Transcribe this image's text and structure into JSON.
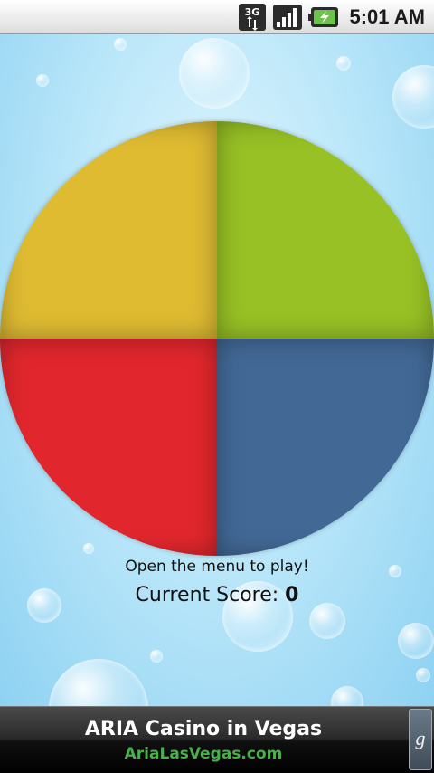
{
  "status_bar": {
    "network_label": "3G",
    "network_icon": "3g-data-icon",
    "signal_icon": "signal-strength-icon",
    "battery_icon": "battery-charging-icon",
    "time": "5:01 AM"
  },
  "game": {
    "quadrants": [
      {
        "name": "yellow",
        "color": "#dfbb32"
      },
      {
        "name": "green",
        "color": "#97c125"
      },
      {
        "name": "red",
        "color": "#e1272d"
      },
      {
        "name": "blue",
        "color": "#426996"
      }
    ],
    "hint": "Open the menu to play!",
    "score_label": "Current Score:",
    "score_value": "0"
  },
  "ad": {
    "title": "ARIA Casino in Vegas",
    "url": "AriaLasVegas.com",
    "badge": "g",
    "badge_icon": "google-ads-icon",
    "url_color": "#49b04a"
  }
}
